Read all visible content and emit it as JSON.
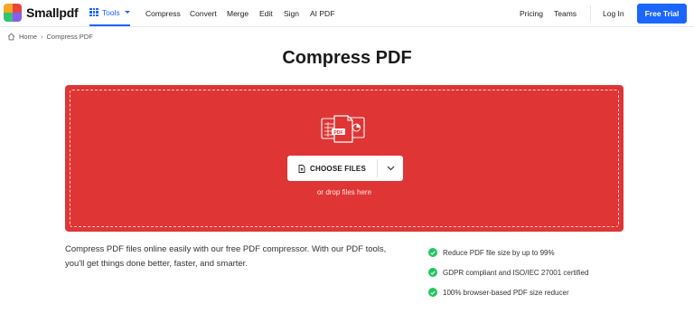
{
  "brand": {
    "name": "Smallpdf"
  },
  "nav": {
    "tools_label": "Tools",
    "items": [
      "Compress",
      "Convert",
      "Merge",
      "Edit",
      "Sign",
      "AI PDF"
    ],
    "right": {
      "pricing": "Pricing",
      "teams": "Teams",
      "login": "Log In",
      "trial": "Free Trial"
    }
  },
  "breadcrumb": {
    "home": "Home",
    "current": "Compress PDF"
  },
  "page_title": "Compress PDF",
  "dropzone": {
    "choose_label": "CHOOSE FILES",
    "drop_text": "or drop files here",
    "icon": "pdf-files-icon"
  },
  "description": "Compress PDF files online easily with our free PDF compressor. With our PDF tools, you'll get things done better, faster, and smarter.",
  "features": [
    "Reduce PDF file size by up to 99%",
    "GDPR compliant and ISO/IEC 27001 certified",
    "100% browser-based PDF size reducer"
  ],
  "colors": {
    "accent": "#1a66ff",
    "dropzone": "#e03535",
    "check": "#22c55e"
  }
}
